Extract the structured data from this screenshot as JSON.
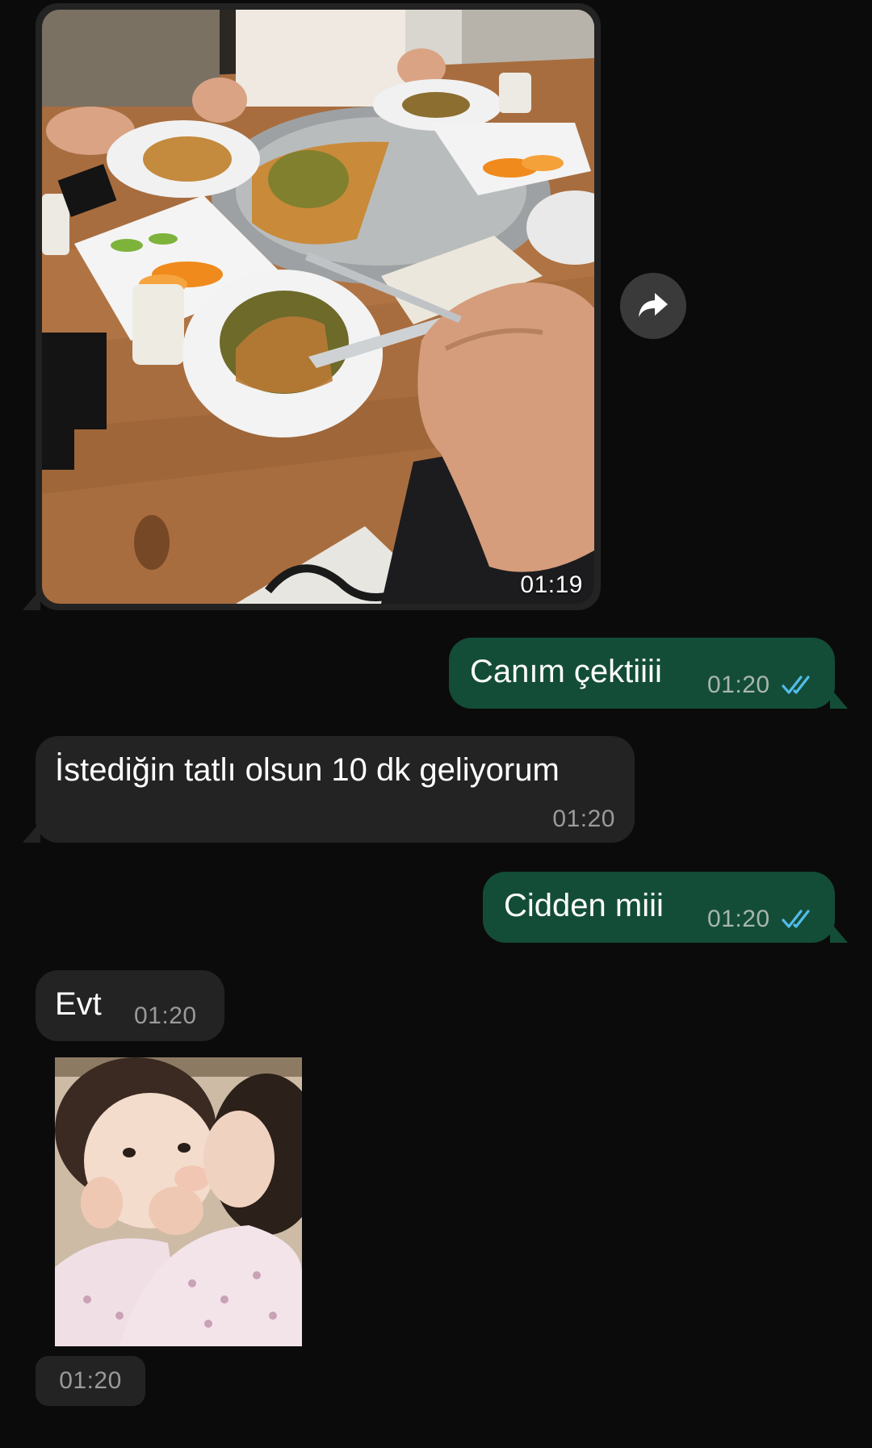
{
  "messages": {
    "photo": {
      "time": "01:19"
    },
    "m1": {
      "text": "Canım çektiiii",
      "time": "01:20",
      "status": "read"
    },
    "m2": {
      "text": "İstediğin tatlı olsun 10 dk geliyorum",
      "time": "01:20"
    },
    "m3": {
      "text": "Cidden miii",
      "time": "01:20",
      "status": "read"
    },
    "m4": {
      "text": "Evt",
      "time": "01:20"
    },
    "sticker": {
      "time": "01:20"
    }
  },
  "colors": {
    "background": "#0b0b0b",
    "incoming_bubble": "#232323",
    "outgoing_bubble": "#144d37",
    "read_ticks": "#53bdeb",
    "forward_button": "#3a3a3a"
  },
  "icons": {
    "forward": "forward-arrow-icon",
    "read_status": "double-check-icon"
  }
}
